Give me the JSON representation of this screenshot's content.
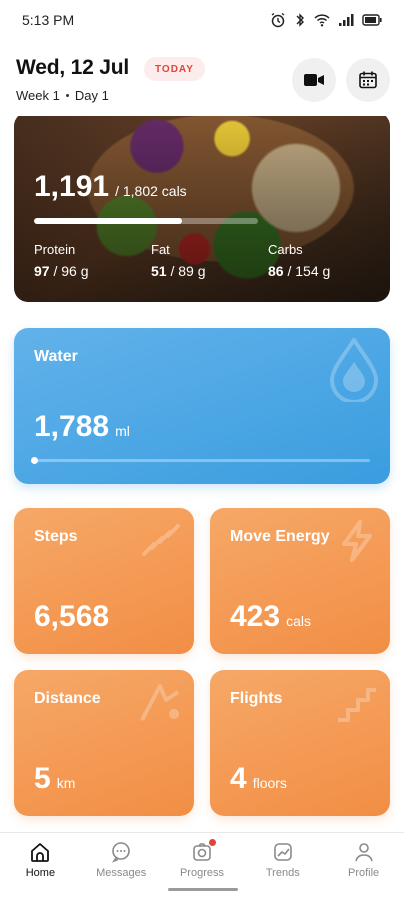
{
  "status_bar": {
    "time": "5:13 PM",
    "icons": [
      "alarm-icon",
      "bluetooth-icon",
      "wifi-icon",
      "signal-icon",
      "battery-icon"
    ]
  },
  "header": {
    "date": "Wed, 12 Jul",
    "today_badge": "TODAY",
    "week": "Week 1",
    "day": "Day 1",
    "actions": [
      "video-icon",
      "calendar-icon"
    ]
  },
  "nutrition": {
    "calories": "1,191",
    "calories_goal": "/ 1,802 cals",
    "calories_progress": 0.66,
    "macros": [
      {
        "label": "Protein",
        "value": "97",
        "goal": "/ 96 g"
      },
      {
        "label": "Fat",
        "value": "51",
        "goal": "/ 89 g"
      },
      {
        "label": "Carbs",
        "value": "86",
        "goal": "/ 154 g"
      }
    ]
  },
  "water": {
    "title": "Water",
    "value": "1,788",
    "unit": "ml",
    "progress": 0.0
  },
  "stats": [
    {
      "title": "Steps",
      "value": "6,568",
      "unit": ""
    },
    {
      "title": "Move Energy",
      "value": "423",
      "unit": "cals"
    },
    {
      "title": "Distance",
      "value": "5",
      "unit": "km"
    },
    {
      "title": "Flights",
      "value": "4",
      "unit": "floors"
    }
  ],
  "nav": {
    "items": [
      {
        "label": "Home",
        "icon": "home-icon",
        "active": true
      },
      {
        "label": "Messages",
        "icon": "messages-icon",
        "active": false
      },
      {
        "label": "Progress",
        "icon": "progress-icon",
        "active": false
      },
      {
        "label": "Trends",
        "icon": "trends-icon",
        "active": false
      },
      {
        "label": "Profile",
        "icon": "profile-icon",
        "active": false
      }
    ]
  },
  "colors": {
    "water_accent": "#3a9ddf",
    "stat_accent": "#f28e45",
    "badge_text": "#e0453a"
  }
}
